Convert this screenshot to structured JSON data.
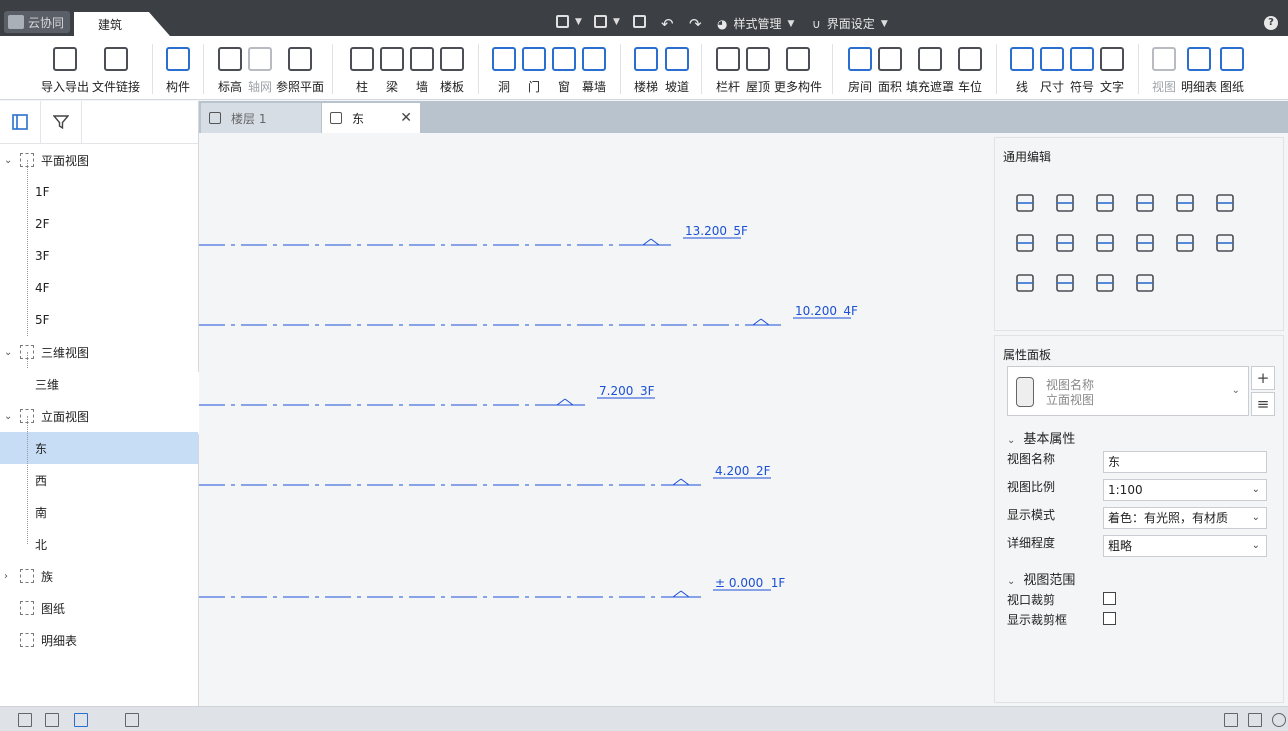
{
  "app": {
    "name": "云协同",
    "active_tab": "建筑"
  },
  "quick_access": {
    "style_manager": "样式管理",
    "ui_settings": "界面设定"
  },
  "ribbon": [
    {
      "id": "cad",
      "label": "导入导出",
      "icon": "cad-import-icon"
    },
    {
      "id": "link",
      "label": "文件链接",
      "icon": "file-link-icon"
    },
    {
      "id": "component",
      "label": "构件",
      "icon": "component-icon"
    },
    {
      "id": "level",
      "label": "标高",
      "icon": "level-icon"
    },
    {
      "id": "grid",
      "label": "轴网",
      "icon": "grid-icon",
      "disabled": true
    },
    {
      "id": "refplane",
      "label": "参照平面",
      "icon": "ref-plane-icon"
    },
    {
      "id": "column",
      "label": "柱",
      "icon": "column-icon"
    },
    {
      "id": "beam",
      "label": "梁",
      "icon": "beam-icon"
    },
    {
      "id": "wall",
      "label": "墙",
      "icon": "wall-icon"
    },
    {
      "id": "floor",
      "label": "楼板",
      "icon": "floor-icon"
    },
    {
      "id": "opening",
      "label": "洞",
      "icon": "opening-icon"
    },
    {
      "id": "door",
      "label": "门",
      "icon": "door-icon"
    },
    {
      "id": "window",
      "label": "窗",
      "icon": "window-icon"
    },
    {
      "id": "curtain",
      "label": "幕墙",
      "icon": "curtain-wall-icon"
    },
    {
      "id": "stair",
      "label": "楼梯",
      "icon": "stair-icon"
    },
    {
      "id": "ramp",
      "label": "坡道",
      "icon": "ramp-icon"
    },
    {
      "id": "railing",
      "label": "栏杆",
      "icon": "railing-icon"
    },
    {
      "id": "roof",
      "label": "屋顶",
      "icon": "roof-icon"
    },
    {
      "id": "more",
      "label": "更多构件",
      "icon": "more-components-icon"
    },
    {
      "id": "room",
      "label": "房间",
      "icon": "room-icon"
    },
    {
      "id": "area",
      "label": "面积",
      "icon": "area-icon"
    },
    {
      "id": "fill",
      "label": "填充遮罩",
      "icon": "fill-mask-icon"
    },
    {
      "id": "parking",
      "label": "车位",
      "icon": "parking-icon"
    },
    {
      "id": "line",
      "label": "线",
      "icon": "line-icon"
    },
    {
      "id": "dim",
      "label": "尺寸",
      "icon": "dimension-icon"
    },
    {
      "id": "symbol",
      "label": "符号",
      "icon": "symbol-icon"
    },
    {
      "id": "text",
      "label": "文字",
      "icon": "text-icon"
    },
    {
      "id": "view",
      "label": "视图",
      "icon": "view-icon",
      "disabled": true
    },
    {
      "id": "schedule",
      "label": "明细表",
      "icon": "schedule-icon"
    },
    {
      "id": "sheet",
      "label": "图纸",
      "icon": "sheet-icon"
    }
  ],
  "tree": [
    {
      "label": "平面视图",
      "level": 0,
      "caret": "open"
    },
    {
      "label": "1F",
      "level": 1
    },
    {
      "label": "2F",
      "level": 1
    },
    {
      "label": "3F",
      "level": 1
    },
    {
      "label": "4F",
      "level": 1
    },
    {
      "label": "5F",
      "level": 1
    },
    {
      "label": "三维视图",
      "level": 0,
      "caret": "open"
    },
    {
      "label": "三维",
      "level": 1
    },
    {
      "label": "立面视图",
      "level": 0,
      "caret": "open"
    },
    {
      "label": "东",
      "level": 1,
      "selected": true
    },
    {
      "label": "西",
      "level": 1
    },
    {
      "label": "南",
      "level": 1
    },
    {
      "label": "北",
      "level": 1
    },
    {
      "label": "族",
      "level": 0,
      "caret": "closed"
    },
    {
      "label": "图纸",
      "level": 0
    },
    {
      "label": "明细表",
      "level": 0
    }
  ],
  "doc_tabs": [
    {
      "label": "楼层 1",
      "active": false
    },
    {
      "label": "东",
      "active": true
    }
  ],
  "levels": [
    {
      "elevation": "13.200",
      "name": "5F"
    },
    {
      "elevation": "10.200",
      "name": "4F"
    },
    {
      "elevation": "7.200",
      "name": "3F"
    },
    {
      "elevation": "4.200",
      "name": "2F"
    },
    {
      "elevation": "± 0.000",
      "name": "1F"
    }
  ],
  "general_edit": {
    "title": "通用编辑",
    "icons": [
      "move-icon",
      "copy-icon",
      "rotate-icon",
      "trim-icon",
      "split-icon",
      "split-gap-icon",
      "array-copy-icon",
      "align-icon",
      "offset-icon",
      "extend-icon",
      "pattern-icon",
      "mirror-icon",
      "delete-icon",
      "3d-array-icon",
      "export-icon",
      "measure-icon"
    ]
  },
  "properties": {
    "title": "属性面板",
    "selector_label": "视图名称",
    "selector_value": "立面视图",
    "basic_section": "基本属性",
    "view_name_label": "视图名称",
    "view_name": "东",
    "scale_label": "视图比例",
    "scale": "1:100",
    "display_mode_label": "显示模式",
    "display_mode": "着色：有光照，有材质",
    "detail_label": "详细程度",
    "detail": "粗略",
    "range_section": "视图范围",
    "crop_label": "视口裁剪",
    "show_crop_label": "显示裁剪框"
  },
  "colors": {
    "accent": "#1a4fd6",
    "selected": "#c7dcf5",
    "topbar": "#3c3f44"
  }
}
